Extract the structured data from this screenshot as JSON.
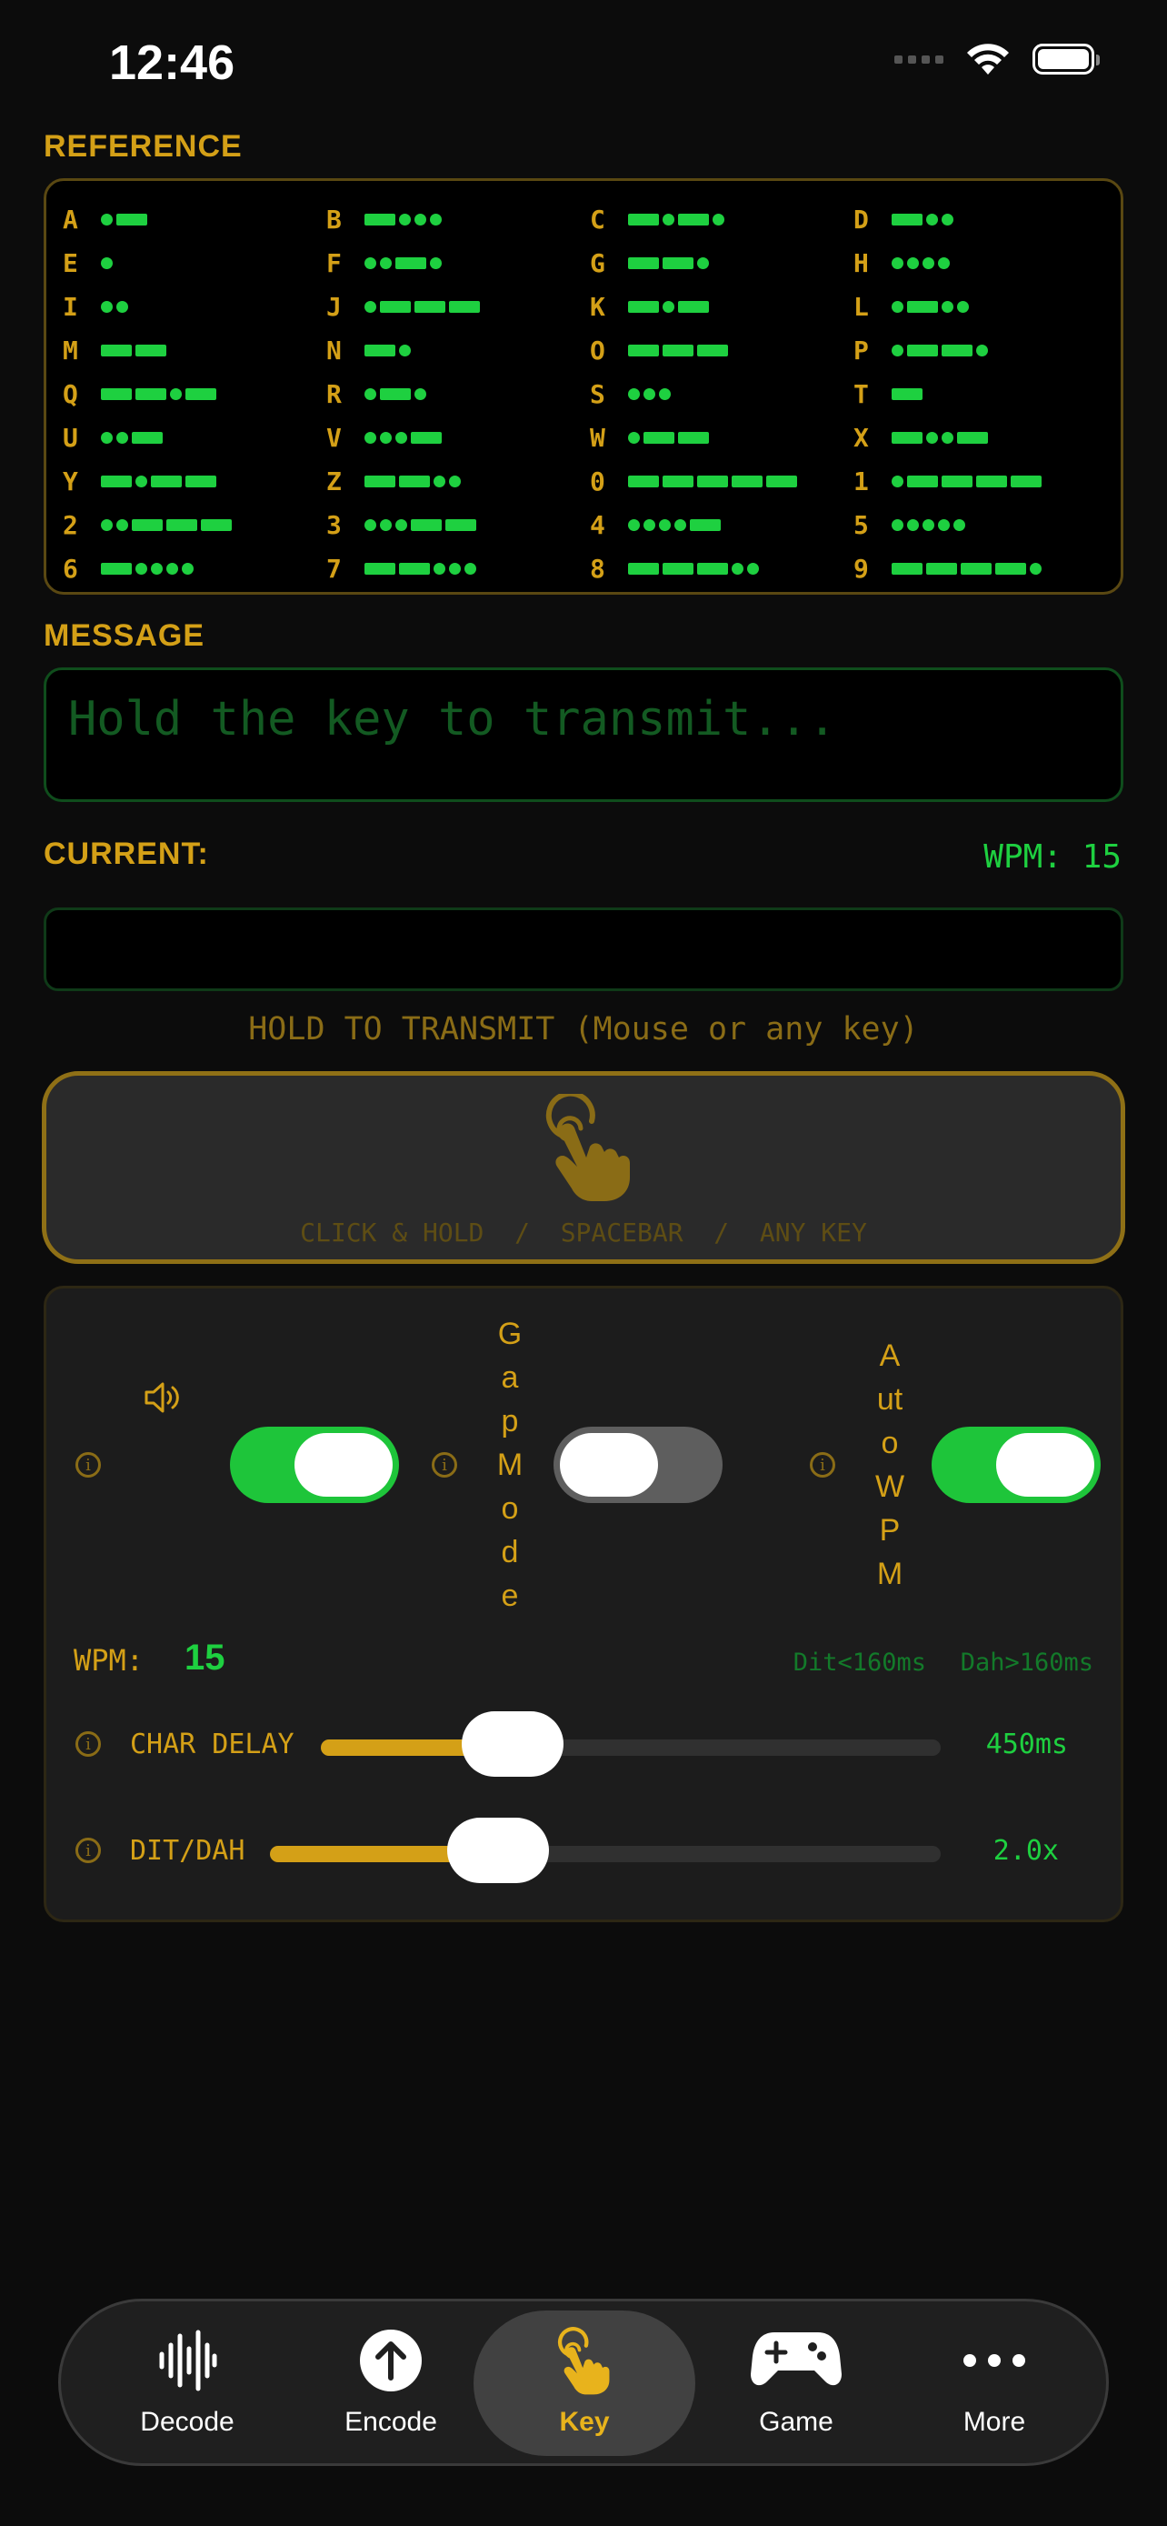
{
  "status": {
    "time": "12:46"
  },
  "reference": {
    "title": "REFERENCE",
    "items": [
      {
        "char": "A",
        "code": ".-"
      },
      {
        "char": "B",
        "code": "-..."
      },
      {
        "char": "C",
        "code": "-.-."
      },
      {
        "char": "D",
        "code": "-.."
      },
      {
        "char": "E",
        "code": "."
      },
      {
        "char": "F",
        "code": "..-."
      },
      {
        "char": "G",
        "code": "--."
      },
      {
        "char": "H",
        "code": "...."
      },
      {
        "char": "I",
        "code": ".."
      },
      {
        "char": "J",
        "code": ".---"
      },
      {
        "char": "K",
        "code": "-.-"
      },
      {
        "char": "L",
        "code": ".-.."
      },
      {
        "char": "M",
        "code": "--"
      },
      {
        "char": "N",
        "code": "-."
      },
      {
        "char": "O",
        "code": "---"
      },
      {
        "char": "P",
        "code": ".--."
      },
      {
        "char": "Q",
        "code": "--.-"
      },
      {
        "char": "R",
        "code": ".-."
      },
      {
        "char": "S",
        "code": "..."
      },
      {
        "char": "T",
        "code": "-"
      },
      {
        "char": "U",
        "code": "..-"
      },
      {
        "char": "V",
        "code": "...-"
      },
      {
        "char": "W",
        "code": ".--"
      },
      {
        "char": "X",
        "code": "-..-"
      },
      {
        "char": "Y",
        "code": "-.--"
      },
      {
        "char": "Z",
        "code": "--.."
      },
      {
        "char": "0",
        "code": "-----"
      },
      {
        "char": "1",
        "code": ".----"
      },
      {
        "char": "2",
        "code": "..---"
      },
      {
        "char": "3",
        "code": "...--"
      },
      {
        "char": "4",
        "code": "....-"
      },
      {
        "char": "5",
        "code": "....."
      },
      {
        "char": "6",
        "code": "-...."
      },
      {
        "char": "7",
        "code": "--..."
      },
      {
        "char": "8",
        "code": "---.."
      },
      {
        "char": "9",
        "code": "----."
      }
    ]
  },
  "message": {
    "title": "MESSAGE",
    "placeholder": "Hold the key to transmit..."
  },
  "current": {
    "title": "CURRENT:",
    "wpm_text": "WPM: 15",
    "value": ""
  },
  "key": {
    "hold_label": "HOLD TO TRANSMIT (Mouse or any key)",
    "hint": "CLICK & HOLD  /  SPACEBAR  /  ANY KEY"
  },
  "settings": {
    "sound_on": true,
    "gap_mode_label": [
      "G",
      "a",
      "p",
      "M",
      "o",
      "d",
      "e"
    ],
    "gap_mode_on": false,
    "auto_wpm_label": [
      "A",
      "ut",
      "o",
      "W",
      "P",
      "M"
    ],
    "auto_wpm_on": true,
    "wpm_label": "WPM:",
    "wpm_value": "15",
    "dit_timing": "Dit<160ms",
    "dah_timing": "Dah>160ms",
    "char_delay": {
      "label": "CHAR DELAY",
      "value": "450ms",
      "fraction": 0.31
    },
    "dit_dah": {
      "label": "DIT/DAH",
      "value": "2.0x",
      "fraction": 0.34
    }
  },
  "colors": {
    "accent": "#d4a017",
    "signal": "#1ed040",
    "toggle_on": "#1ec53a"
  },
  "tabs": [
    {
      "label": "Decode",
      "icon": "waveform-icon"
    },
    {
      "label": "Encode",
      "icon": "arrow-up-circle-icon"
    },
    {
      "label": "Key",
      "icon": "tap-hand-icon",
      "active": true
    },
    {
      "label": "Game",
      "icon": "gamepad-icon"
    },
    {
      "label": "More",
      "icon": "ellipsis-icon"
    }
  ]
}
